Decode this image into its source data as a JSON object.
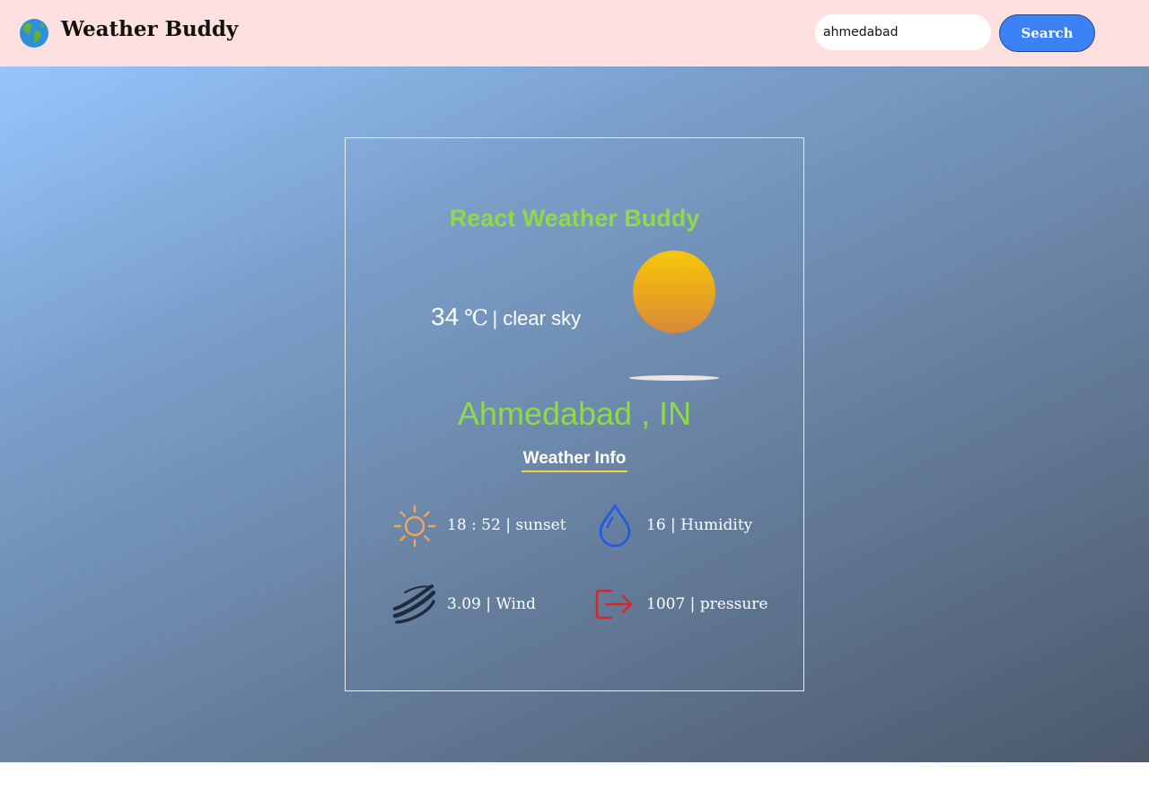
{
  "navbar": {
    "brand_title": "Weather Buddy",
    "search_value": "ahmedabad",
    "search_button_label": "Search",
    "background_color": "#ffe0e0",
    "button_color": "#3b82f6"
  },
  "card": {
    "title": "React Weather Buddy",
    "temperature": "34",
    "temperature_unit": "℃",
    "condition": "| clear sky",
    "condition_icon": "sun-icon",
    "location": "Ahmedabad , IN",
    "info_heading": "Weather Info",
    "accent_color": "#8fd94a",
    "stats": {
      "sunset": {
        "text": "18 : 52 | sunset",
        "icon": "sunset-icon",
        "color": "#f2a65a"
      },
      "humidity": {
        "text": "16 | Humidity",
        "icon": "water-drop-icon",
        "color": "#2458e6"
      },
      "wind": {
        "text": "3.09 | Wind",
        "icon": "wind-icon",
        "color": "#1e2a3d"
      },
      "pressure": {
        "text": "1007 | pressure",
        "icon": "pressure-icon",
        "color": "#d6262b"
      }
    }
  }
}
